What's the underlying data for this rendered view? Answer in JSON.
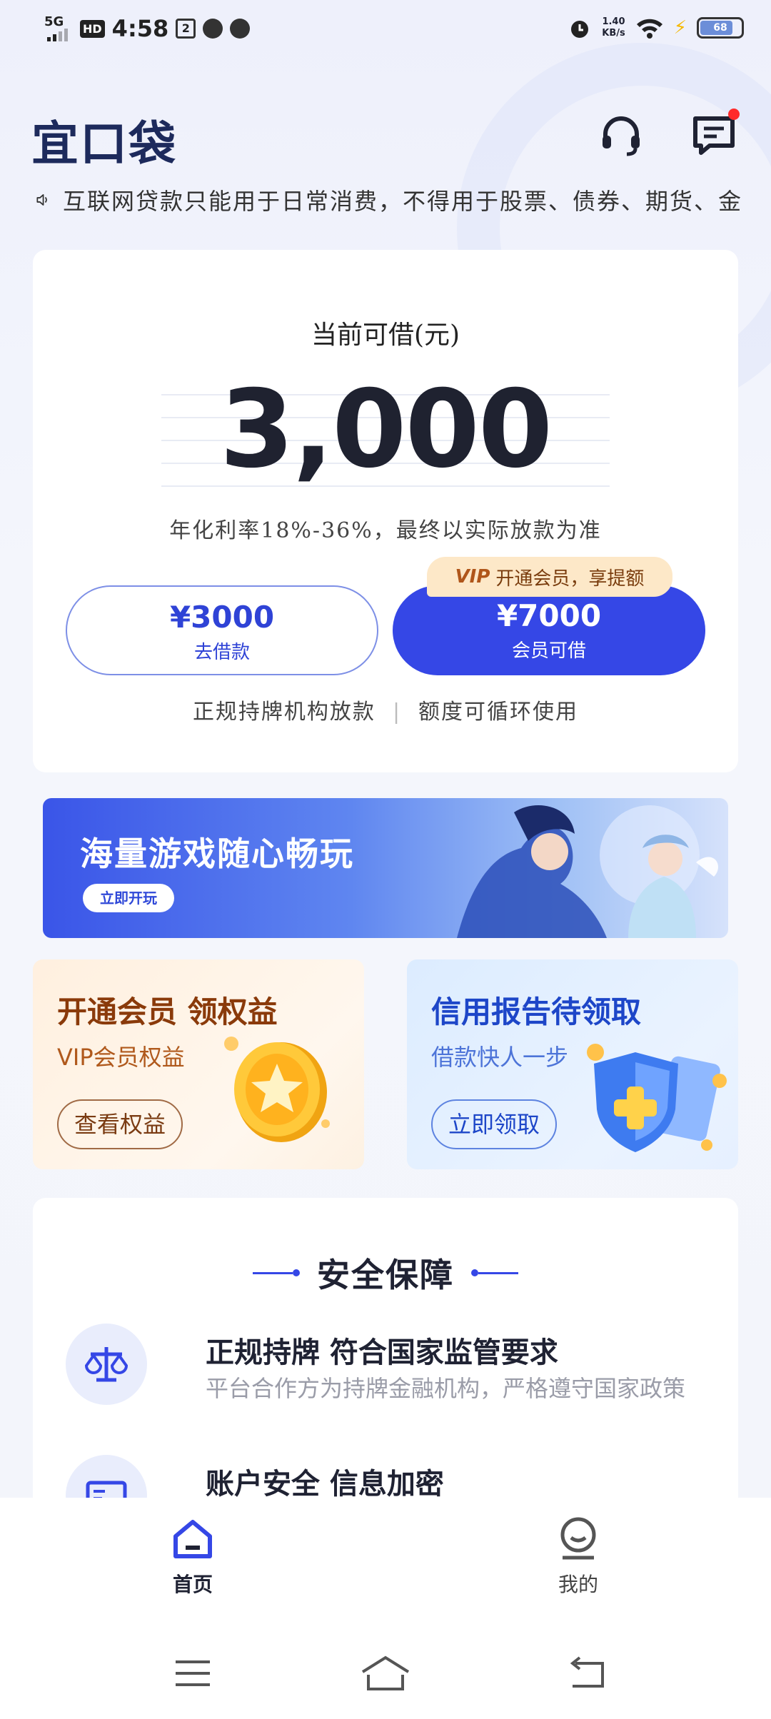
{
  "status_bar": {
    "network": "5G",
    "hd": "HD",
    "time": "4:58",
    "speed_value": "1.40",
    "speed_unit": "KB/s",
    "battery": "68"
  },
  "header": {
    "logo": "宜口袋",
    "support_icon": "headset-icon",
    "message_icon": "message-icon"
  },
  "notice": {
    "text": "互联网贷款只能用于日常消费，不得用于股票、债券、期货、金"
  },
  "loan_card": {
    "title": "当前可借(元)",
    "amount": "3,000",
    "rate_note": "年化利率18%-36%，最终以实际放款为准",
    "borrow_button": {
      "amount": "¥3000",
      "label": "去借款"
    },
    "vip_button": {
      "amount": "¥7000",
      "label": "会员可借"
    },
    "vip_tag": {
      "badge": "VIP",
      "text": "开通会员，享提额"
    },
    "trust_left": "正规持牌机构放款",
    "trust_sep": "|",
    "trust_right": "额度可循环使用"
  },
  "banner": {
    "title": "海量游戏随心畅玩",
    "button": "立即开玩"
  },
  "promo_vip": {
    "title": "开通会员 领权益",
    "subtitle": "VIP会员权益",
    "button": "查看权益"
  },
  "promo_credit": {
    "title": "信用报告待领取",
    "subtitle": "借款快人一步",
    "button": "立即领取"
  },
  "security": {
    "title": "安全保障",
    "items": [
      {
        "icon": "scale-icon",
        "heading": "正规持牌 符合国家监管要求",
        "desc": "平台合作方为持牌金融机构，严格遵守国家政策"
      },
      {
        "icon": "id-card-icon",
        "heading": "账户安全 信息加密",
        "desc": ""
      }
    ]
  },
  "tabbar": {
    "home": "首页",
    "mine": "我的"
  },
  "colors": {
    "primary": "#3547e6",
    "logo": "#1d2a5c",
    "vip_tag_bg": "#fde8c8"
  }
}
